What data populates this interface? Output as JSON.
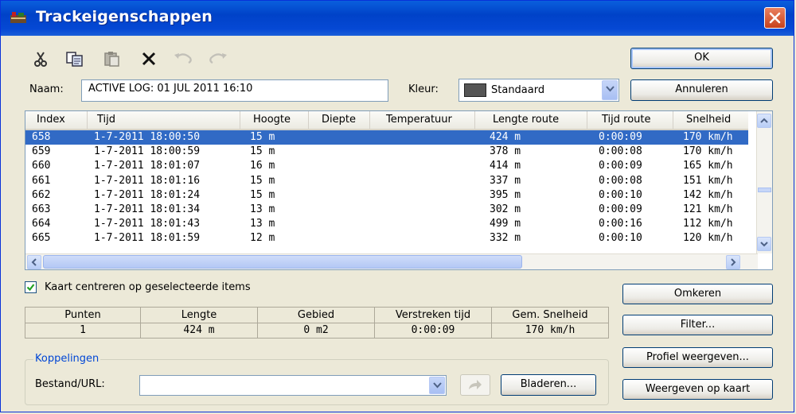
{
  "window": {
    "title": "Trackeigenschappen"
  },
  "toolbar": {
    "icons": [
      "cut-icon",
      "copy-icon",
      "paste-icon",
      "delete-icon",
      "undo-icon",
      "redo-icon"
    ]
  },
  "name_label": "Naam:",
  "name_value": "ACTIVE LOG: 01 JUL 2011 16:10",
  "color_label": "Kleur:",
  "color_value": "Standaard",
  "color_swatch": "#555555",
  "buttons": {
    "ok": "OK",
    "cancel": "Annuleren",
    "reverse": "Omkeren",
    "filter": "Filter...",
    "profile": "Profiel weergeven...",
    "show_on_map": "Weergeven op kaart",
    "browse": "Bladeren..."
  },
  "table": {
    "columns": [
      "Index",
      "Tijd",
      "Hoogte",
      "Diepte",
      "Temperatuur",
      "Lengte route",
      "Tijd route",
      "Snelheid"
    ],
    "rows": [
      [
        "658",
        "1-7-2011 18:00:50",
        "15 m",
        "",
        "",
        "424 m",
        "0:00:09",
        "170 km/h"
      ],
      [
        "659",
        "1-7-2011 18:00:59",
        "15 m",
        "",
        "",
        "378 m",
        "0:00:08",
        "170 km/h"
      ],
      [
        "660",
        "1-7-2011 18:01:07",
        "16 m",
        "",
        "",
        "414 m",
        "0:00:09",
        "165 km/h"
      ],
      [
        "661",
        "1-7-2011 18:01:16",
        "15 m",
        "",
        "",
        "337 m",
        "0:00:08",
        "151 km/h"
      ],
      [
        "662",
        "1-7-2011 18:01:24",
        "15 m",
        "",
        "",
        "395 m",
        "0:00:10",
        "142 km/h"
      ],
      [
        "663",
        "1-7-2011 18:01:34",
        "13 m",
        "",
        "",
        "302 m",
        "0:00:09",
        "121 km/h"
      ],
      [
        "664",
        "1-7-2011 18:01:43",
        "13 m",
        "",
        "",
        "499 m",
        "0:00:16",
        "112 km/h"
      ],
      [
        "665",
        "1-7-2011 18:01:59",
        "12 m",
        "",
        "",
        "332 m",
        "0:00:10",
        "120 km/h"
      ]
    ],
    "selected_row": 0
  },
  "center_checkbox": {
    "label": "Kaart centreren op geselecteerde items",
    "checked": true
  },
  "stats": [
    {
      "header": "Punten",
      "value": "1"
    },
    {
      "header": "Lengte",
      "value": "424 m"
    },
    {
      "header": "Gebied",
      "value": "0 m2"
    },
    {
      "header": "Verstreken tijd",
      "value": "0:00:09"
    },
    {
      "header": "Gem. Snelheid",
      "value": "170 km/h"
    }
  ],
  "links": {
    "group_title": "Koppelingen",
    "file_label": "Bestand/URL:",
    "file_value": ""
  }
}
